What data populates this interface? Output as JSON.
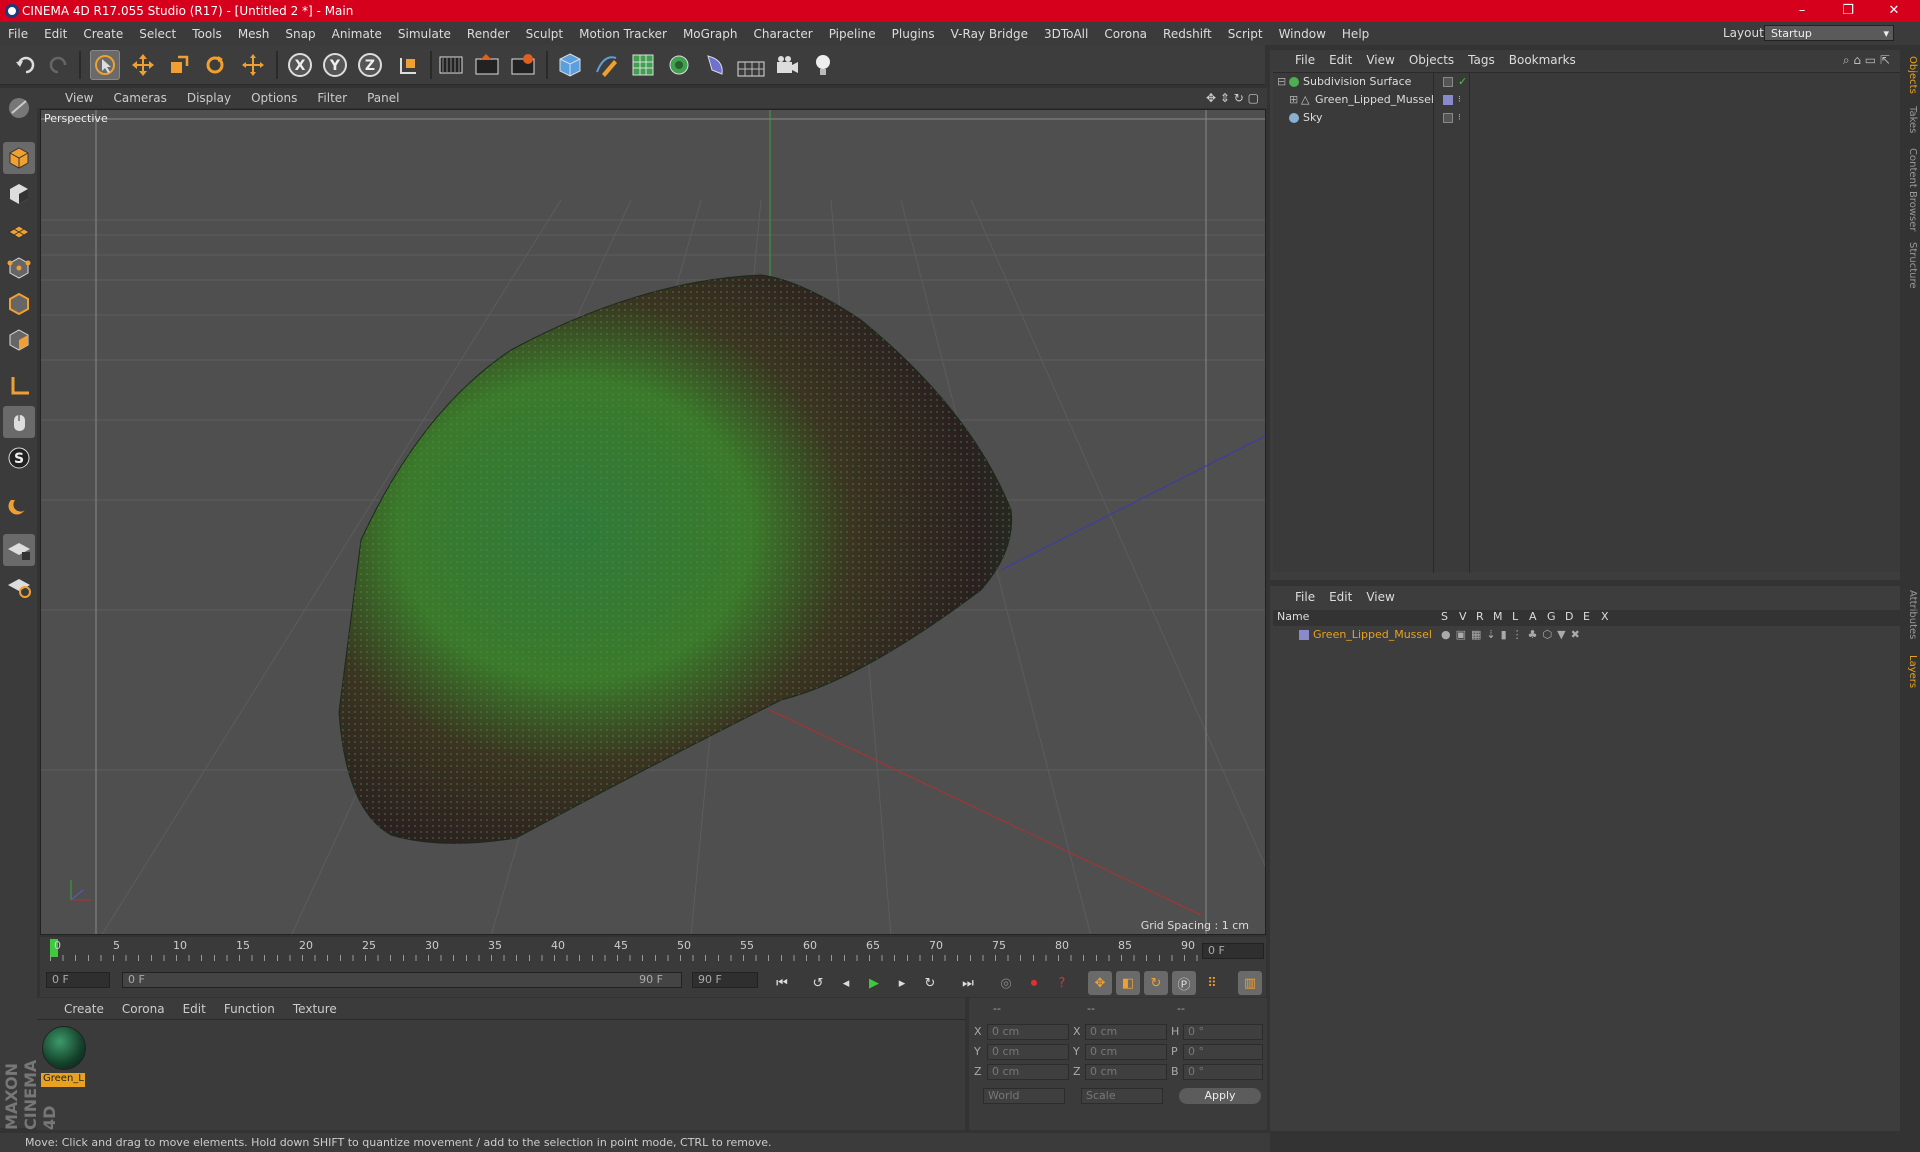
{
  "titlebar": {
    "title": "CINEMA 4D R17.055 Studio (R17) - [Untitled 2 *] - Main",
    "minimize": "–",
    "maximize": "❐",
    "close": "✕"
  },
  "menubar": {
    "items": [
      "File",
      "Edit",
      "Create",
      "Select",
      "Tools",
      "Mesh",
      "Snap",
      "Animate",
      "Simulate",
      "Render",
      "Sculpt",
      "Motion Tracker",
      "MoGraph",
      "Character",
      "Pipeline",
      "Plugins",
      "V-Ray Bridge",
      "3DToAll",
      "Corona",
      "Redshift",
      "Script",
      "Window",
      "Help"
    ],
    "layout_label": "Layout:",
    "layout_value": "Startup"
  },
  "toolbar": {
    "icons": [
      "undo-icon",
      "redo-icon",
      "select-arrow-icon",
      "move-icon",
      "scale-icon",
      "rotate-icon",
      "live-select-icon",
      "x-axis-icon",
      "y-axis-icon",
      "z-axis-icon",
      "coordinate-system-icon",
      "render-view-icon",
      "render-picture-viewer-icon",
      "edit-render-settings-icon",
      "cube-icon",
      "pen-icon",
      "subdivision-icon",
      "mograph-cloner-icon",
      "deformer-icon",
      "floor-icon",
      "camera-icon",
      "light-icon"
    ],
    "axis_labels": [
      "X",
      "Y",
      "Z"
    ]
  },
  "viewport": {
    "menu": [
      "View",
      "Cameras",
      "Display",
      "Options",
      "Filter",
      "Panel"
    ],
    "label": "Perspective",
    "grid_spacing": "Grid Spacing : 1 cm"
  },
  "timeline": {
    "ticks": [
      "0",
      "5",
      "10",
      "15",
      "20",
      "25",
      "30",
      "35",
      "40",
      "45",
      "50",
      "55",
      "60",
      "65",
      "70",
      "75",
      "80",
      "85",
      "90"
    ],
    "current_frame": "0 F",
    "start_frame": "0 F",
    "range_start": "0 F",
    "range_end": "90 F",
    "end_frame": "90 F"
  },
  "material_manager": {
    "menu": [
      "Create",
      "Corona",
      "Edit",
      "Function",
      "Texture"
    ],
    "material_name": "Green_L"
  },
  "coordinates": {
    "header": [
      "--",
      "--",
      "--"
    ],
    "rows": [
      {
        "axis": "X",
        "pos": "0 cm",
        "axis2": "X",
        "size": "0 cm",
        "rot_label": "H",
        "rot": "0 °"
      },
      {
        "axis": "Y",
        "pos": "0 cm",
        "axis2": "Y",
        "size": "0 cm",
        "rot_label": "P",
        "rot": "0 °"
      },
      {
        "axis": "Z",
        "pos": "0 cm",
        "axis2": "Z",
        "size": "0 cm",
        "rot_label": "B",
        "rot": "0 °"
      }
    ],
    "mode": "World",
    "size_mode": "Scale",
    "apply": "Apply"
  },
  "status": {
    "text": "Move: Click and drag to move elements. Hold down SHIFT to quantize movement / add to the selection in point mode, CTRL to remove."
  },
  "object_manager": {
    "menu": [
      "File",
      "Edit",
      "View",
      "Objects",
      "Tags",
      "Bookmarks"
    ],
    "objects": [
      {
        "name": "Subdivision Surface",
        "color": "#4caf50"
      },
      {
        "name": "Green_Lipped_Mussel",
        "color": "#8a8acb"
      },
      {
        "name": "Sky",
        "color": "#8ab0d0"
      }
    ]
  },
  "layer_manager": {
    "menu": [
      "File",
      "Edit",
      "View"
    ],
    "columns": [
      "Name",
      "S",
      "V",
      "R",
      "M",
      "L",
      "A",
      "G",
      "D",
      "E",
      "X"
    ],
    "layers": [
      {
        "name": "Green_Lipped_Mussel",
        "color": "#e8a21f"
      }
    ]
  },
  "right_tabs": [
    "Objects",
    "Takes",
    "Content Browser",
    "Structure",
    "Attributes",
    "Layers"
  ],
  "brand": "MAXON CINEMA 4D",
  "colors": {
    "titlebar": "#d6001c",
    "accent": "#e8a21f",
    "mussel_green": "#2e7a3a"
  }
}
